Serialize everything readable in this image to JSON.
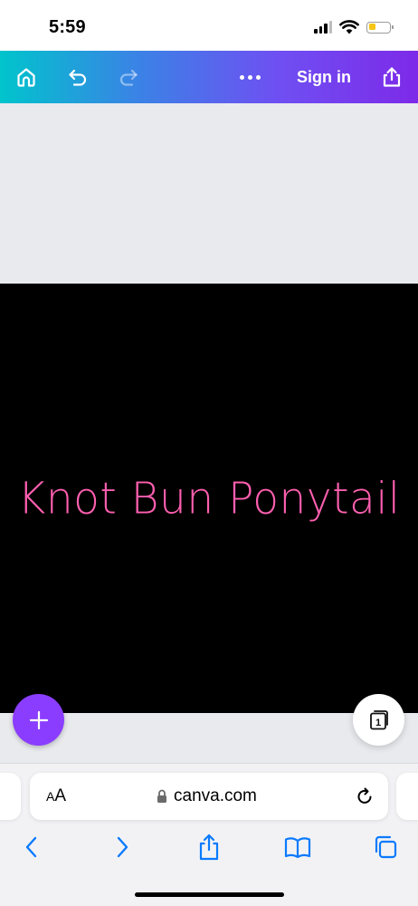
{
  "status_bar": {
    "time": "5:59",
    "battery_level": 0.35,
    "battery_color": "#f5c518"
  },
  "toolbar": {
    "gradient_colors": [
      "#00c4cc",
      "#3b82e6",
      "#6f4ff2",
      "#7d2ae8"
    ],
    "home_icon": "home-icon",
    "undo_icon": "undo-icon",
    "redo_icon": "redo-icon",
    "more_icon": "more-icon",
    "sign_in_label": "Sign in",
    "share_icon": "share-icon"
  },
  "canvas": {
    "background": "#000000",
    "design_text": "Knot Bun Ponytail",
    "text_color": "#ff5fb0"
  },
  "fab": {
    "add_icon": "plus-icon",
    "add_color": "#8b3dff",
    "page_count": "1"
  },
  "safari": {
    "text_size_small": "A",
    "text_size_big": "A",
    "url": "canva.com",
    "lock_icon": "lock-icon",
    "reload_icon": "reload-icon",
    "nav_icons": [
      "back-icon",
      "forward-icon",
      "share-icon",
      "bookmarks-icon",
      "tabs-icon"
    ],
    "accent": "#0a7aff"
  }
}
